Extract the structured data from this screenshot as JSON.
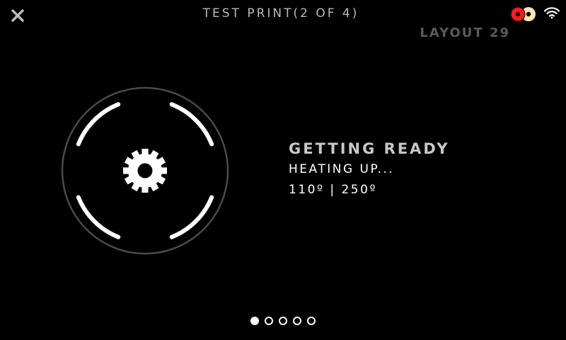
{
  "header": {
    "title": "TEST PRINT(2 OF 4)",
    "layout_label": "LAYOUT 29"
  },
  "status": {
    "title": "GETTING READY",
    "subtitle": "HEATING UP...",
    "temperatures": "110º | 250º"
  },
  "icons": {
    "close": "close-icon",
    "filament": "filament-spools-icon",
    "wifi": "wifi-icon",
    "gear": "gear-icon"
  },
  "colors": {
    "background": "#000000",
    "filament_primary": "#ff1a1a",
    "filament_secondary": "#f3e9b5",
    "dial_ring": "#4a4a4a",
    "dial_segments": "#ffffff"
  },
  "pagination": {
    "total": 5,
    "current": 1
  }
}
